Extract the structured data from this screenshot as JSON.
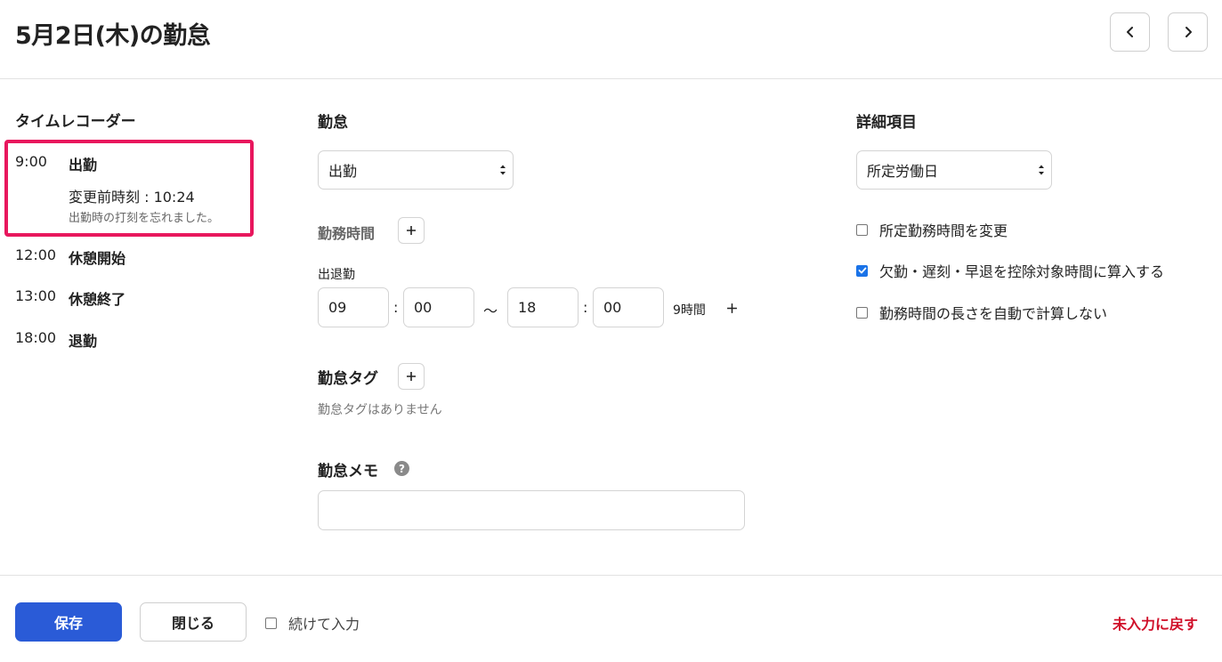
{
  "header": {
    "title": "5月2日(木)の勤怠",
    "prev_icon": "chevron-left-icon",
    "next_icon": "chevron-right-icon"
  },
  "time_recorder": {
    "title": "タイムレコーダー",
    "entries": [
      {
        "time": "9:00",
        "label": "出勤",
        "sub": "変更前時刻 : 10:24",
        "note": "出勤時の打刻を忘れました。"
      },
      {
        "time": "12:00",
        "label": "休憩開始"
      },
      {
        "time": "13:00",
        "label": "休憩終了"
      },
      {
        "time": "18:00",
        "label": "退勤"
      }
    ]
  },
  "attendance": {
    "title": "勤怠",
    "type_value": "出勤",
    "work_time_title": "勤務時間",
    "clock_label": "出退勤",
    "start_hour": "09",
    "start_min": "00",
    "colon": ":",
    "tilde": "～",
    "end_hour": "18",
    "end_min": "00",
    "duration": "9時間",
    "tag_title": "勤怠タグ",
    "tag_empty": "勤怠タグはありません",
    "memo_title": "勤怠メモ",
    "help_glyph": "?"
  },
  "details": {
    "title": "詳細項目",
    "day_type_value": "所定労働日",
    "options": [
      {
        "label": "所定勤務時間を変更",
        "checked": false
      },
      {
        "label": "欠勤・遅刻・早退を控除対象時間に算入する",
        "checked": true
      },
      {
        "label": "勤務時間の長さを自動で計算しない",
        "checked": false
      }
    ]
  },
  "footer": {
    "save_label": "保存",
    "close_label": "閉じる",
    "continue_label": "続けて入力",
    "continue_checked": false,
    "revert_label": "未入力に戻す"
  },
  "colors": {
    "primary": "#2a5bd7",
    "highlight": "#e8175d",
    "danger": "#d0102a"
  }
}
